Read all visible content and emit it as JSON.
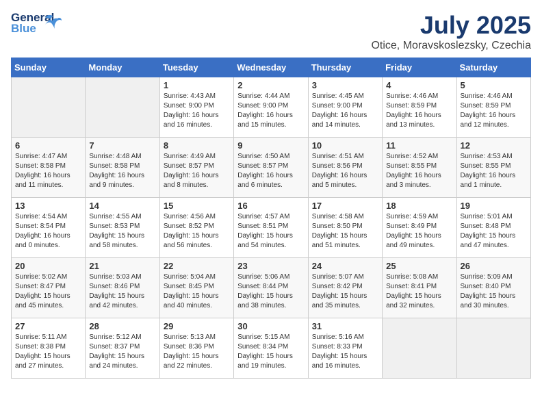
{
  "header": {
    "logo_general": "General",
    "logo_blue": "Blue",
    "month_year": "July 2025",
    "location": "Otice, Moravskoslezsky, Czechia"
  },
  "days_of_week": [
    "Sunday",
    "Monday",
    "Tuesday",
    "Wednesday",
    "Thursday",
    "Friday",
    "Saturday"
  ],
  "weeks": [
    [
      {
        "day": "",
        "info": ""
      },
      {
        "day": "",
        "info": ""
      },
      {
        "day": "1",
        "info": "Sunrise: 4:43 AM\nSunset: 9:00 PM\nDaylight: 16 hours and 16 minutes."
      },
      {
        "day": "2",
        "info": "Sunrise: 4:44 AM\nSunset: 9:00 PM\nDaylight: 16 hours and 15 minutes."
      },
      {
        "day": "3",
        "info": "Sunrise: 4:45 AM\nSunset: 9:00 PM\nDaylight: 16 hours and 14 minutes."
      },
      {
        "day": "4",
        "info": "Sunrise: 4:46 AM\nSunset: 8:59 PM\nDaylight: 16 hours and 13 minutes."
      },
      {
        "day": "5",
        "info": "Sunrise: 4:46 AM\nSunset: 8:59 PM\nDaylight: 16 hours and 12 minutes."
      }
    ],
    [
      {
        "day": "6",
        "info": "Sunrise: 4:47 AM\nSunset: 8:58 PM\nDaylight: 16 hours and 11 minutes."
      },
      {
        "day": "7",
        "info": "Sunrise: 4:48 AM\nSunset: 8:58 PM\nDaylight: 16 hours and 9 minutes."
      },
      {
        "day": "8",
        "info": "Sunrise: 4:49 AM\nSunset: 8:57 PM\nDaylight: 16 hours and 8 minutes."
      },
      {
        "day": "9",
        "info": "Sunrise: 4:50 AM\nSunset: 8:57 PM\nDaylight: 16 hours and 6 minutes."
      },
      {
        "day": "10",
        "info": "Sunrise: 4:51 AM\nSunset: 8:56 PM\nDaylight: 16 hours and 5 minutes."
      },
      {
        "day": "11",
        "info": "Sunrise: 4:52 AM\nSunset: 8:55 PM\nDaylight: 16 hours and 3 minutes."
      },
      {
        "day": "12",
        "info": "Sunrise: 4:53 AM\nSunset: 8:55 PM\nDaylight: 16 hours and 1 minute."
      }
    ],
    [
      {
        "day": "13",
        "info": "Sunrise: 4:54 AM\nSunset: 8:54 PM\nDaylight: 16 hours and 0 minutes."
      },
      {
        "day": "14",
        "info": "Sunrise: 4:55 AM\nSunset: 8:53 PM\nDaylight: 15 hours and 58 minutes."
      },
      {
        "day": "15",
        "info": "Sunrise: 4:56 AM\nSunset: 8:52 PM\nDaylight: 15 hours and 56 minutes."
      },
      {
        "day": "16",
        "info": "Sunrise: 4:57 AM\nSunset: 8:51 PM\nDaylight: 15 hours and 54 minutes."
      },
      {
        "day": "17",
        "info": "Sunrise: 4:58 AM\nSunset: 8:50 PM\nDaylight: 15 hours and 51 minutes."
      },
      {
        "day": "18",
        "info": "Sunrise: 4:59 AM\nSunset: 8:49 PM\nDaylight: 15 hours and 49 minutes."
      },
      {
        "day": "19",
        "info": "Sunrise: 5:01 AM\nSunset: 8:48 PM\nDaylight: 15 hours and 47 minutes."
      }
    ],
    [
      {
        "day": "20",
        "info": "Sunrise: 5:02 AM\nSunset: 8:47 PM\nDaylight: 15 hours and 45 minutes."
      },
      {
        "day": "21",
        "info": "Sunrise: 5:03 AM\nSunset: 8:46 PM\nDaylight: 15 hours and 42 minutes."
      },
      {
        "day": "22",
        "info": "Sunrise: 5:04 AM\nSunset: 8:45 PM\nDaylight: 15 hours and 40 minutes."
      },
      {
        "day": "23",
        "info": "Sunrise: 5:06 AM\nSunset: 8:44 PM\nDaylight: 15 hours and 38 minutes."
      },
      {
        "day": "24",
        "info": "Sunrise: 5:07 AM\nSunset: 8:42 PM\nDaylight: 15 hours and 35 minutes."
      },
      {
        "day": "25",
        "info": "Sunrise: 5:08 AM\nSunset: 8:41 PM\nDaylight: 15 hours and 32 minutes."
      },
      {
        "day": "26",
        "info": "Sunrise: 5:09 AM\nSunset: 8:40 PM\nDaylight: 15 hours and 30 minutes."
      }
    ],
    [
      {
        "day": "27",
        "info": "Sunrise: 5:11 AM\nSunset: 8:38 PM\nDaylight: 15 hours and 27 minutes."
      },
      {
        "day": "28",
        "info": "Sunrise: 5:12 AM\nSunset: 8:37 PM\nDaylight: 15 hours and 24 minutes."
      },
      {
        "day": "29",
        "info": "Sunrise: 5:13 AM\nSunset: 8:36 PM\nDaylight: 15 hours and 22 minutes."
      },
      {
        "day": "30",
        "info": "Sunrise: 5:15 AM\nSunset: 8:34 PM\nDaylight: 15 hours and 19 minutes."
      },
      {
        "day": "31",
        "info": "Sunrise: 5:16 AM\nSunset: 8:33 PM\nDaylight: 15 hours and 16 minutes."
      },
      {
        "day": "",
        "info": ""
      },
      {
        "day": "",
        "info": ""
      }
    ]
  ]
}
